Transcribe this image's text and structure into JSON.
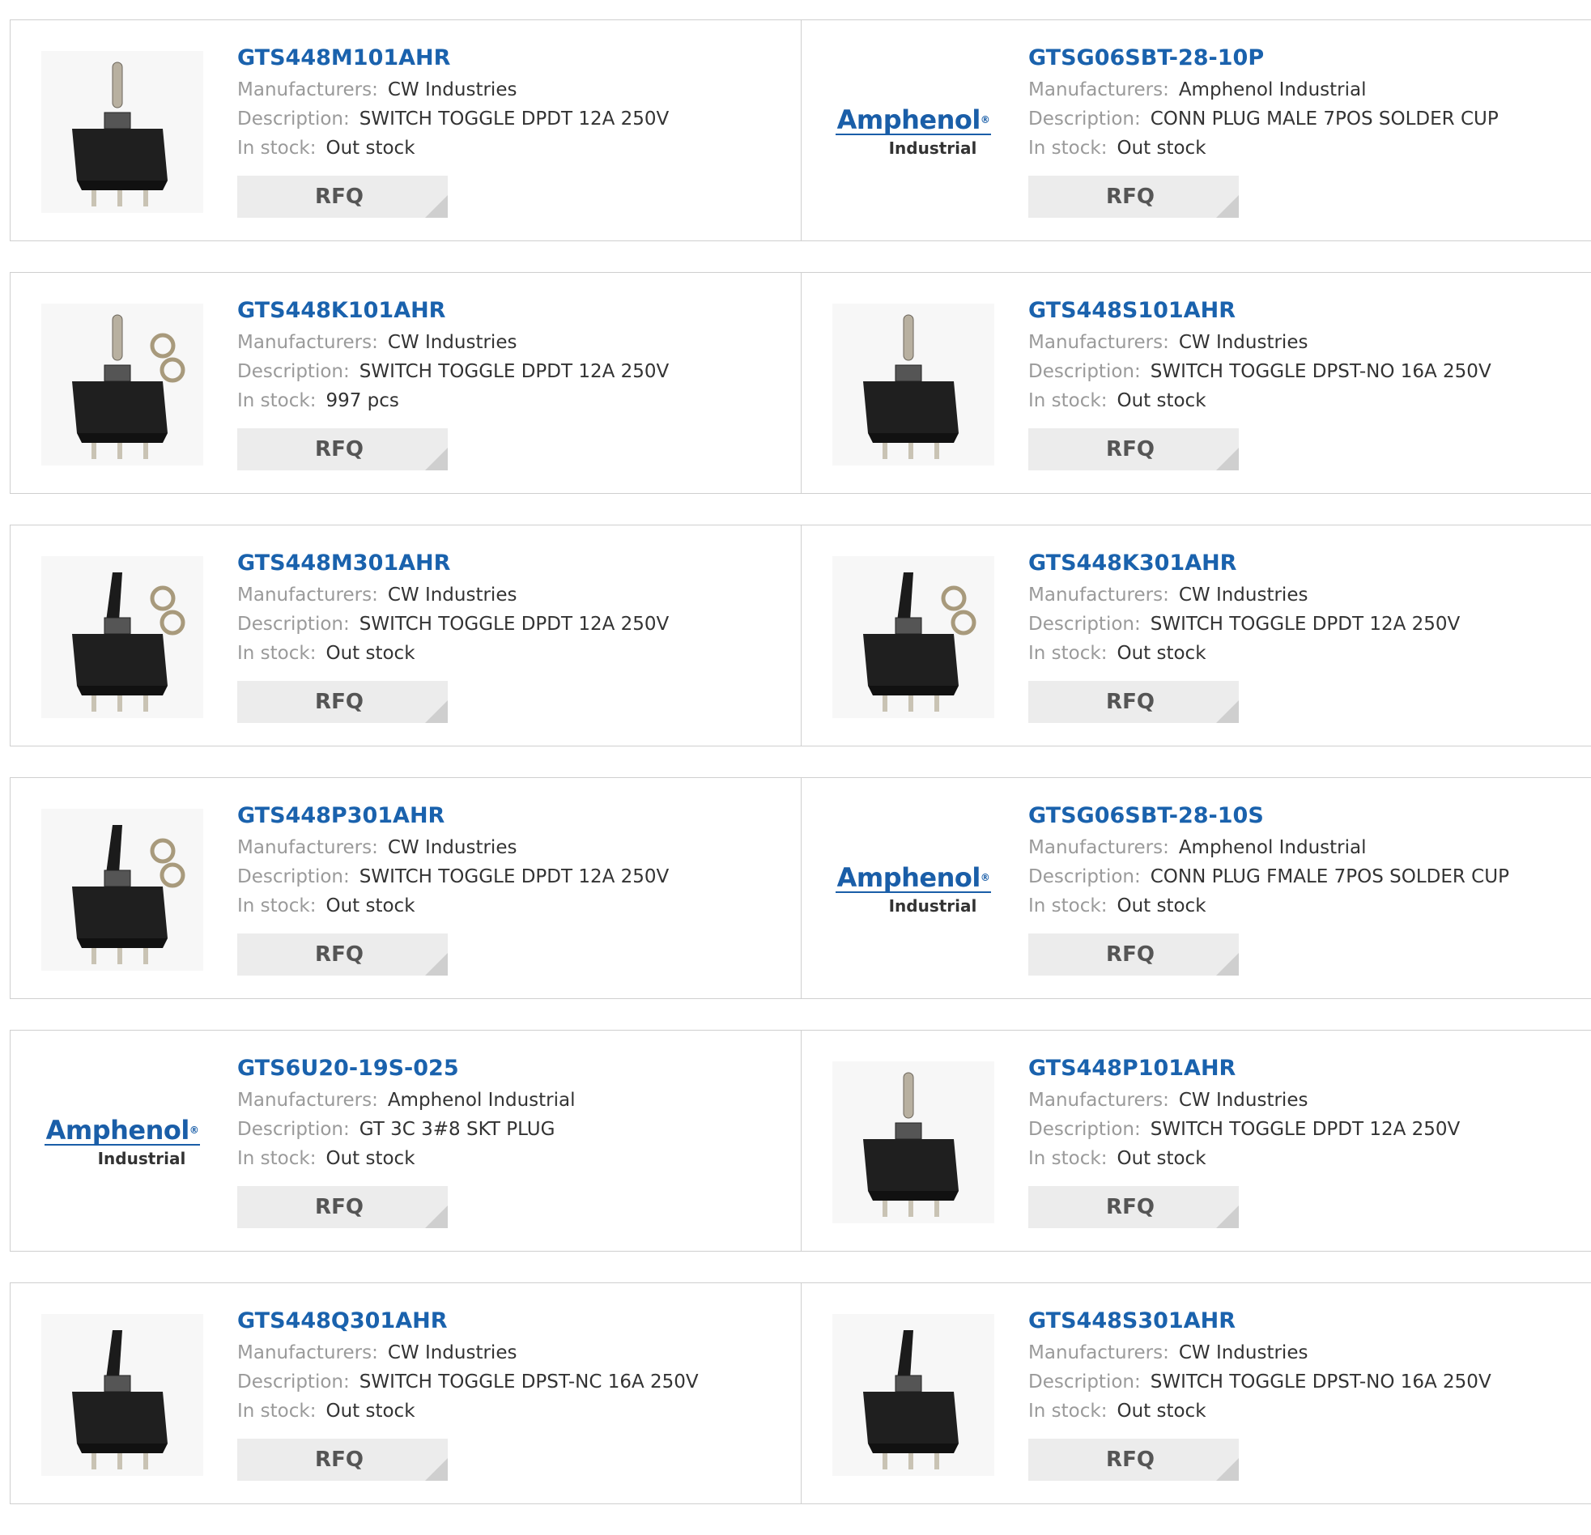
{
  "labels": {
    "manufacturers": "Manufacturers:",
    "description": "Description:",
    "stock": "In stock:",
    "rfq": "RFQ"
  },
  "logo": {
    "main": "Amphenol",
    "registered": "®",
    "sub": "Industrial"
  },
  "colors": {
    "part_link": "#1a62ad",
    "label": "#9a9a9a",
    "value": "#333333",
    "rfq_bg": "#ececec"
  },
  "products": [
    {
      "part": "GTS448M101AHR",
      "manufacturer": "CW Industries",
      "description": "SWITCH TOGGLE DPDT 12A 250V",
      "stock": "Out stock",
      "image": "toggle-switch-bat"
    },
    {
      "part": "GTSG06SBT-28-10P",
      "manufacturer": "Amphenol Industrial",
      "description": "CONN PLUG MALE 7POS SOLDER CUP",
      "stock": "Out stock",
      "image": "amphenol-logo"
    },
    {
      "part": "GTS448K101AHR",
      "manufacturer": "CW Industries",
      "description": "SWITCH TOGGLE DPDT 12A 250V",
      "stock": "997 pcs",
      "image": "toggle-switch-bat-nuts"
    },
    {
      "part": "GTS448S101AHR",
      "manufacturer": "CW Industries",
      "description": "SWITCH TOGGLE DPST-NO 16A 250V",
      "stock": "Out stock",
      "image": "toggle-switch-bat"
    },
    {
      "part": "GTS448M301AHR",
      "manufacturer": "CW Industries",
      "description": "SWITCH TOGGLE DPDT 12A 250V",
      "stock": "Out stock",
      "image": "toggle-switch-paddle-nuts"
    },
    {
      "part": "GTS448K301AHR",
      "manufacturer": "CW Industries",
      "description": "SWITCH TOGGLE DPDT 12A 250V",
      "stock": "Out stock",
      "image": "toggle-switch-paddle-nuts"
    },
    {
      "part": "GTS448P301AHR",
      "manufacturer": "CW Industries",
      "description": "SWITCH TOGGLE DPDT 12A 250V",
      "stock": "Out stock",
      "image": "toggle-switch-paddle-nuts"
    },
    {
      "part": "GTSG06SBT-28-10S",
      "manufacturer": "Amphenol Industrial",
      "description": "CONN PLUG FMALE 7POS SOLDER CUP",
      "stock": "Out stock",
      "image": "amphenol-logo"
    },
    {
      "part": "GTS6U20-19S-025",
      "manufacturer": "Amphenol Industrial",
      "description": "GT 3C 3#8 SKT PLUG",
      "stock": "Out stock",
      "image": "amphenol-logo"
    },
    {
      "part": "GTS448P101AHR",
      "manufacturer": "CW Industries",
      "description": "SWITCH TOGGLE DPDT 12A 250V",
      "stock": "Out stock",
      "image": "toggle-switch-bat"
    },
    {
      "part": "GTS448Q301AHR",
      "manufacturer": "CW Industries",
      "description": "SWITCH TOGGLE DPST-NC 16A 250V",
      "stock": "Out stock",
      "image": "toggle-switch-paddle"
    },
    {
      "part": "GTS448S301AHR",
      "manufacturer": "CW Industries",
      "description": "SWITCH TOGGLE DPST-NO 16A 250V",
      "stock": "Out stock",
      "image": "toggle-switch-paddle"
    }
  ]
}
